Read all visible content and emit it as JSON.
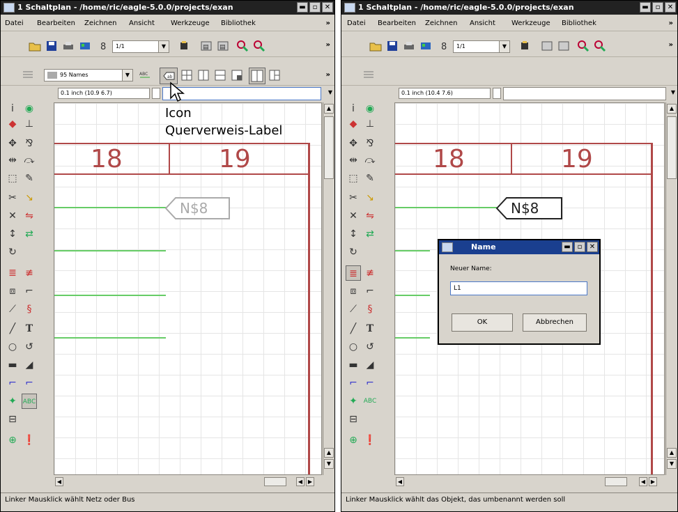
{
  "left_window": {
    "title": "1 Schaltplan - /home/ric/eagle-5.0.0/projects/exan",
    "menu": [
      "Datei",
      "Bearbeiten",
      "Zeichnen",
      "Ansicht",
      "Werkzeuge",
      "Bibliothek"
    ],
    "zoom_combo": "1/1",
    "names_combo": "95 Names",
    "coordinates": "0.1 inch (10.9 6.7)",
    "column_labels": [
      "18",
      "19"
    ],
    "net_label": "N$8",
    "status": "Linker Mausklick wählt Netz oder Bus",
    "annotation_line1": "Icon",
    "annotation_line2": "Querverweis-Label"
  },
  "right_window": {
    "title": "1 Schaltplan - /home/ric/eagle-5.0.0/projects/exan",
    "menu": [
      "Datei",
      "Bearbeiten",
      "Zeichnen",
      "Ansicht",
      "Werkzeuge",
      "Bibliothek"
    ],
    "zoom_combo": "1/1",
    "coordinates": "0.1 inch (10.4 7.6)",
    "column_labels": [
      "18",
      "19"
    ],
    "net_label": "N$8",
    "status": "Linker Mausklick wählt das Objekt, das umbenannt werden soll"
  },
  "dialog": {
    "title": "Name",
    "label": "Neuer Name:",
    "value": "L1",
    "ok": "OK",
    "cancel": "Abbrechen"
  },
  "colors": {
    "grid": "#e5e5e5",
    "frame": "#b04848",
    "net": "#66cc66",
    "title_bg": "#222222"
  }
}
